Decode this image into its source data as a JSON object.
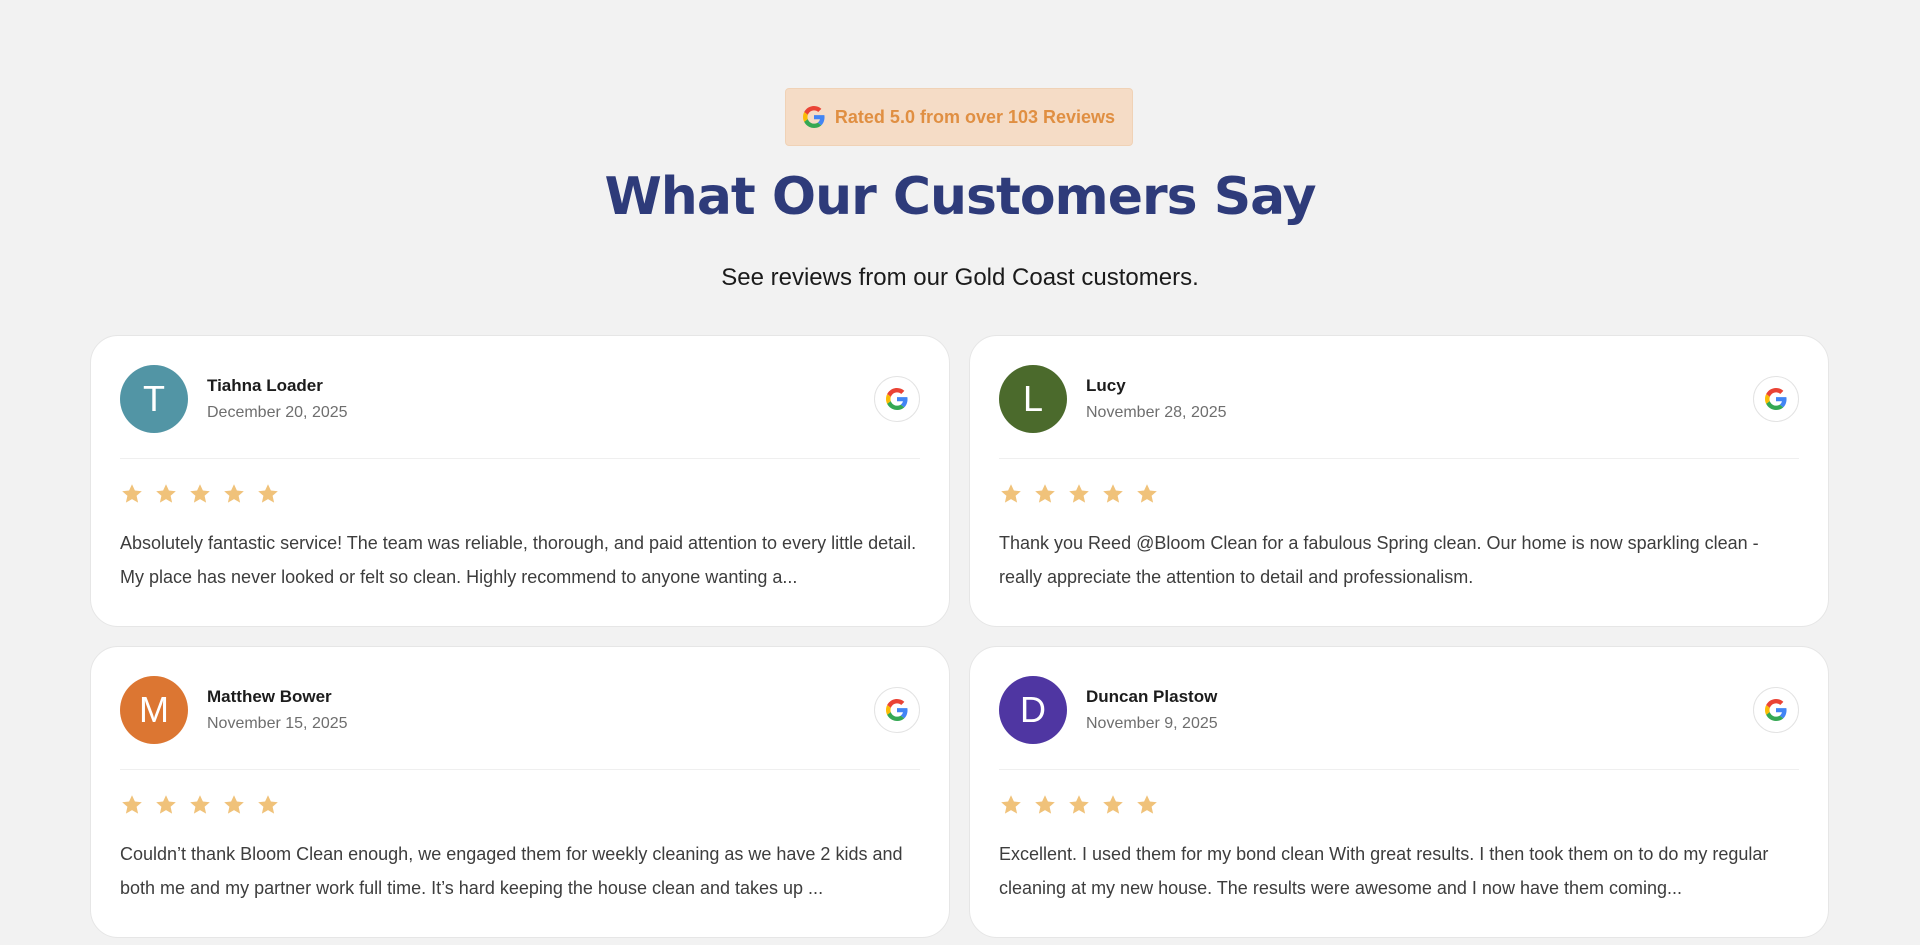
{
  "header": {
    "badge_text": "Rated 5.0 from over 103 Reviews",
    "badge_icon": "google-g-icon",
    "title": "What Our Customers Say",
    "subtitle": "See reviews from our Gold Coast customers."
  },
  "colors": {
    "page_bg": "#f2f2f2",
    "badge_bg": "#f5dcc6",
    "badge_text": "#e08f42",
    "title": "#2e3b7a",
    "star": "#f0c27a"
  },
  "reviews": [
    {
      "initial": "T",
      "name": "Tiahna Loader",
      "date": "December 20, 2025",
      "rating": 5,
      "avatar_color": "#5295a5",
      "text": "Absolutely fantastic service! The team was reliable, thorough, and paid attention to every little detail. My place has never looked or felt so clean. Highly recommend to anyone wanting a..."
    },
    {
      "initial": "L",
      "name": "Lucy",
      "date": "November 28, 2025",
      "rating": 5,
      "avatar_color": "#4b6a2c",
      "text": "Thank you Reed @Bloom Clean for a fabulous Spring clean. Our home is now sparkling clean -really appreciate the attention to detail and professionalism."
    },
    {
      "initial": "M",
      "name": "Matthew Bower",
      "date": "November 15, 2025",
      "rating": 5,
      "avatar_color": "#dc7632",
      "text": "Couldn’t thank Bloom Clean enough, we engaged them for weekly cleaning as we have 2 kids and both me and my partner work full time. It’s hard keeping the house clean and takes up ..."
    },
    {
      "initial": "D",
      "name": "Duncan Plastow",
      "date": "November 9, 2025",
      "rating": 5,
      "avatar_color": "#4f36a2",
      "text": "Excellent. I used them for my bond clean With great results. I then took them on to do my regular cleaning at my new house. The results were awesome and I now have them coming..."
    }
  ]
}
